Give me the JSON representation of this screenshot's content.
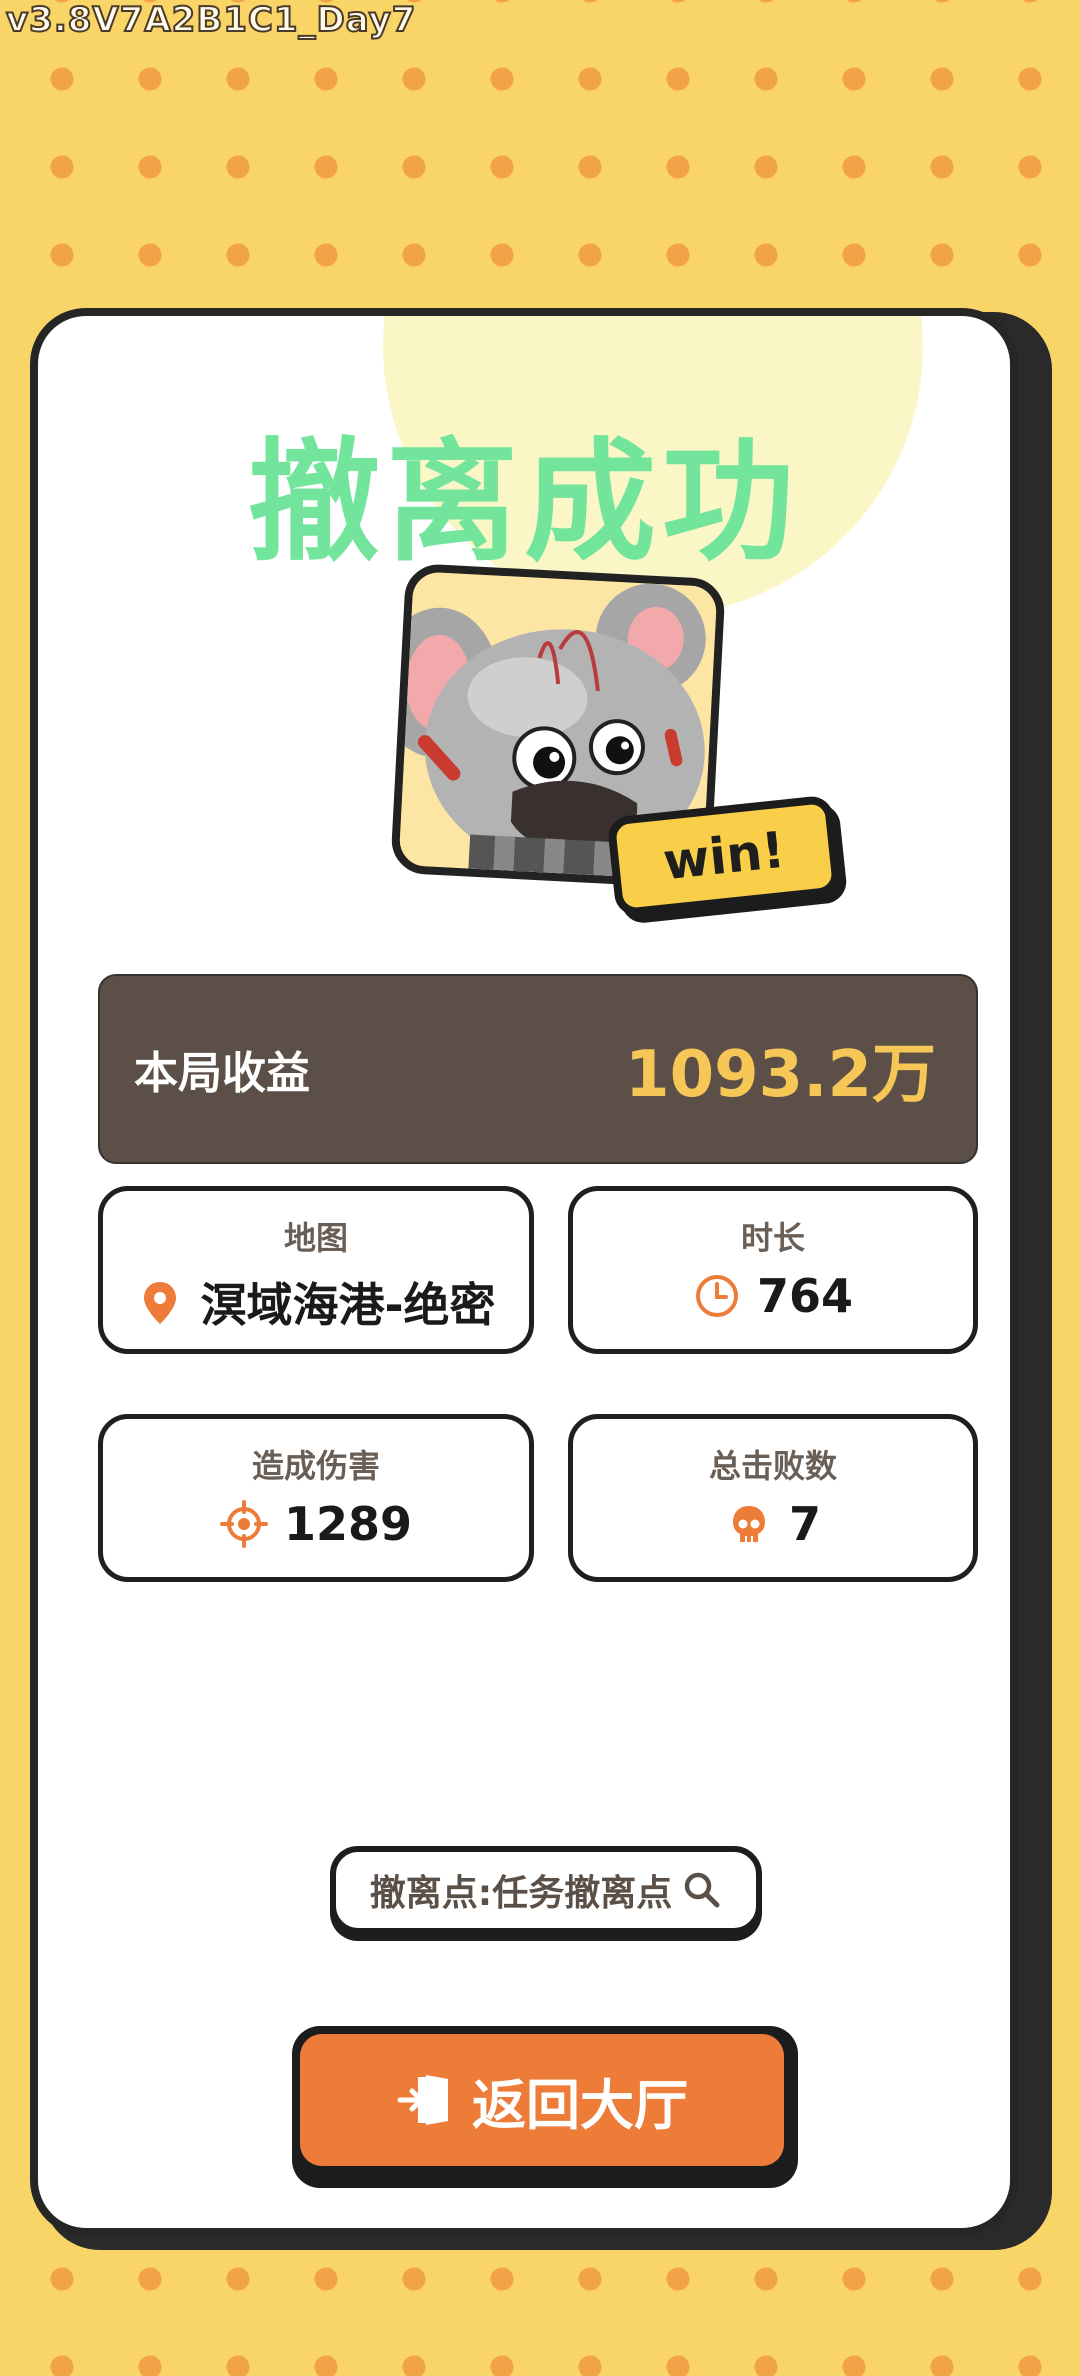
{
  "version": "v3.8V7A2B1C1_Day7",
  "title": "撤离成功",
  "badge": "win!",
  "earnings": {
    "label": "本局收益",
    "value": "1093.2万"
  },
  "stats": {
    "map": {
      "label": "地图",
      "value": "溟域海港-绝密",
      "icon": "location-pin-icon"
    },
    "duration": {
      "label": "时长",
      "value": "764",
      "icon": "clock-icon"
    },
    "damage": {
      "label": "造成伤害",
      "value": "1289",
      "icon": "crosshair-icon"
    },
    "kills": {
      "label": "总击败数",
      "value": "7",
      "icon": "skull-icon"
    }
  },
  "extract_point": {
    "label": "撤离点:任务撤离点",
    "icon": "search-icon"
  },
  "return_button": {
    "label": "返回大厅",
    "icon": "exit-door-icon"
  },
  "colors": {
    "background": "#f9d567",
    "dots": "#f2a347",
    "title": "#72e49c",
    "earnings_bg": "#5b4f47",
    "earnings_value": "#f6c757",
    "accent": "#ee7c39"
  }
}
